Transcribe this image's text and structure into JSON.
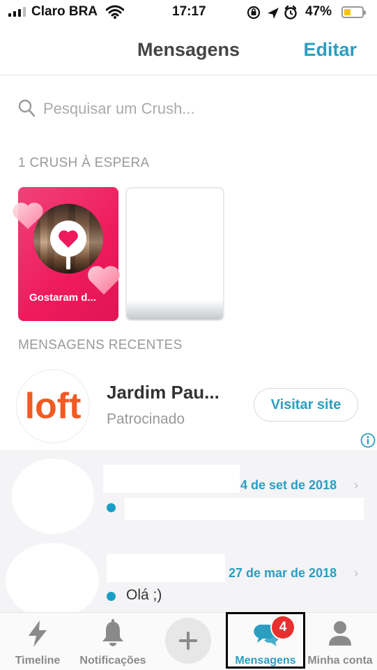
{
  "status_bar": {
    "carrier": "Claro BRA",
    "time": "17:17",
    "battery_percent": "47%",
    "battery_level": 0.47,
    "icons": [
      "signal-icon",
      "wifi-icon",
      "rotation-lock-icon",
      "location-arrow-icon",
      "alarm-icon",
      "battery-icon"
    ]
  },
  "header": {
    "title": "Mensagens",
    "edit_label": "Editar"
  },
  "search": {
    "placeholder": "Pesquisar um Crush...",
    "icon": "search-icon"
  },
  "crushes": {
    "section_label": "1 CRUSH À ESPERA",
    "cards": [
      {
        "caption": "Gostaram d...",
        "icon": "heart-pin-icon"
      }
    ]
  },
  "recent": {
    "section_label": "MENSAGENS RECENTES"
  },
  "ad": {
    "logo_text": "loft",
    "title": "Jardim Pau...",
    "subtitle": "Patrocinado",
    "button_label": "Visitar site",
    "info_icon": "info-icon"
  },
  "conversations": [
    {
      "date": "4 de set de 2018",
      "preview": ""
    },
    {
      "date": "27 de mar de 2018",
      "preview": "Olá ;)"
    }
  ],
  "tabs": [
    {
      "label": "Timeline",
      "icon": "lightning-icon"
    },
    {
      "label": "Notificações",
      "icon": "bell-icon"
    },
    {
      "label": "",
      "icon": "plus-icon"
    },
    {
      "label": "Mensagens",
      "icon": "chat-bubbles-icon",
      "badge": "4",
      "active": true
    },
    {
      "label": "Minha conta",
      "icon": "person-icon"
    }
  ],
  "colors": {
    "accent": "#2b9ec0",
    "badge": "#e8312f",
    "crush_card": "#ee1a5c",
    "loft_orange": "#f05a23"
  }
}
